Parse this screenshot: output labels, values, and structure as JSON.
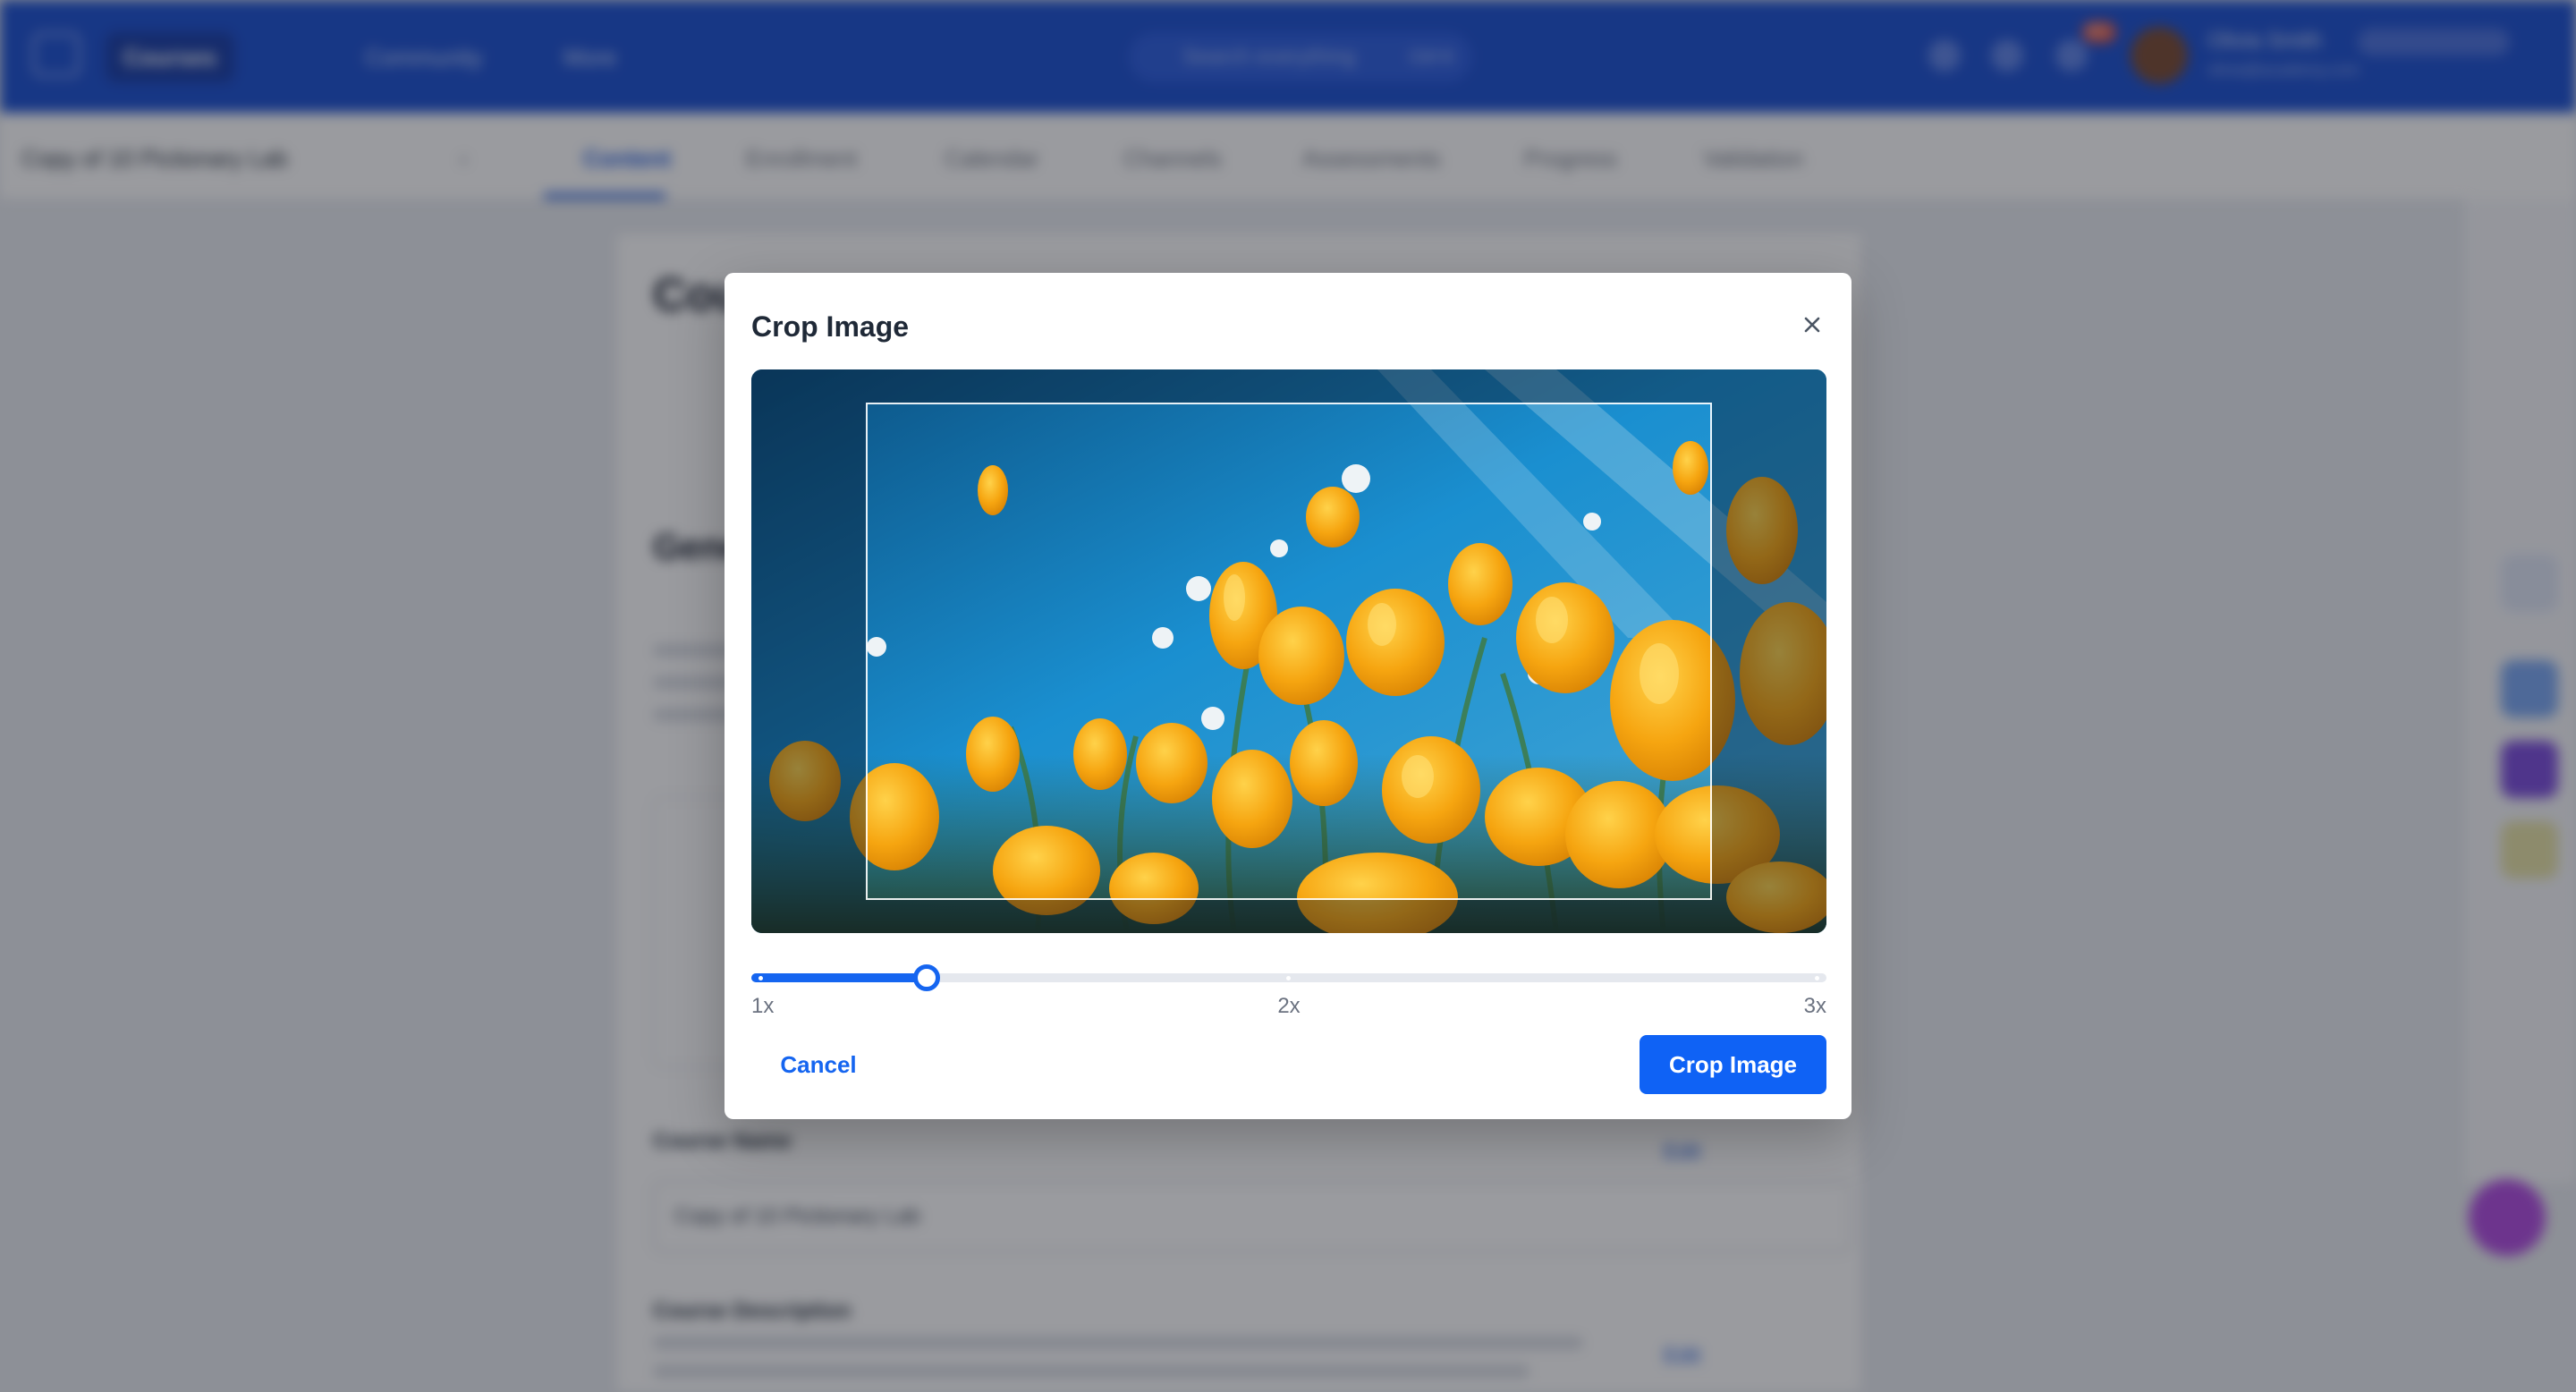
{
  "app": {
    "nav": [
      {
        "label": "Courses",
        "active": true
      },
      {
        "label": "Community",
        "active": false
      },
      {
        "label": "More",
        "active": false
      }
    ],
    "search_placeholder": "Search everything",
    "search_shortcut": "Ctrl K",
    "notification_count": "99+",
    "user_name": "Olivia Smith",
    "user_email": "olivia@academy.com",
    "course_name": "Copy of 10 Pictionary Lab",
    "tabs": [
      "Content",
      "Enrollment",
      "Calendar",
      "Channels",
      "Assessments",
      "Progress",
      "Validation"
    ],
    "page_title": "Course",
    "section_title": "General",
    "course_name_label": "Course Name",
    "course_name_value": "Copy of 10 Pictionary Lab",
    "course_description_label": "Course Description",
    "edit_label": "Edit",
    "colors": {
      "header": "#1a4fd1",
      "accent": "#1a56db"
    }
  },
  "modal": {
    "title": "Crop Image",
    "close_icon": "close-icon",
    "image_subject": "orange poppies against blue sky",
    "zoom": {
      "min_label": "1x",
      "mid_label": "2x",
      "max_label": "3x",
      "value": 1.32
    },
    "cancel_label": "Cancel",
    "confirm_label": "Crop Image",
    "colors": {
      "primary": "#0f62f5"
    }
  }
}
